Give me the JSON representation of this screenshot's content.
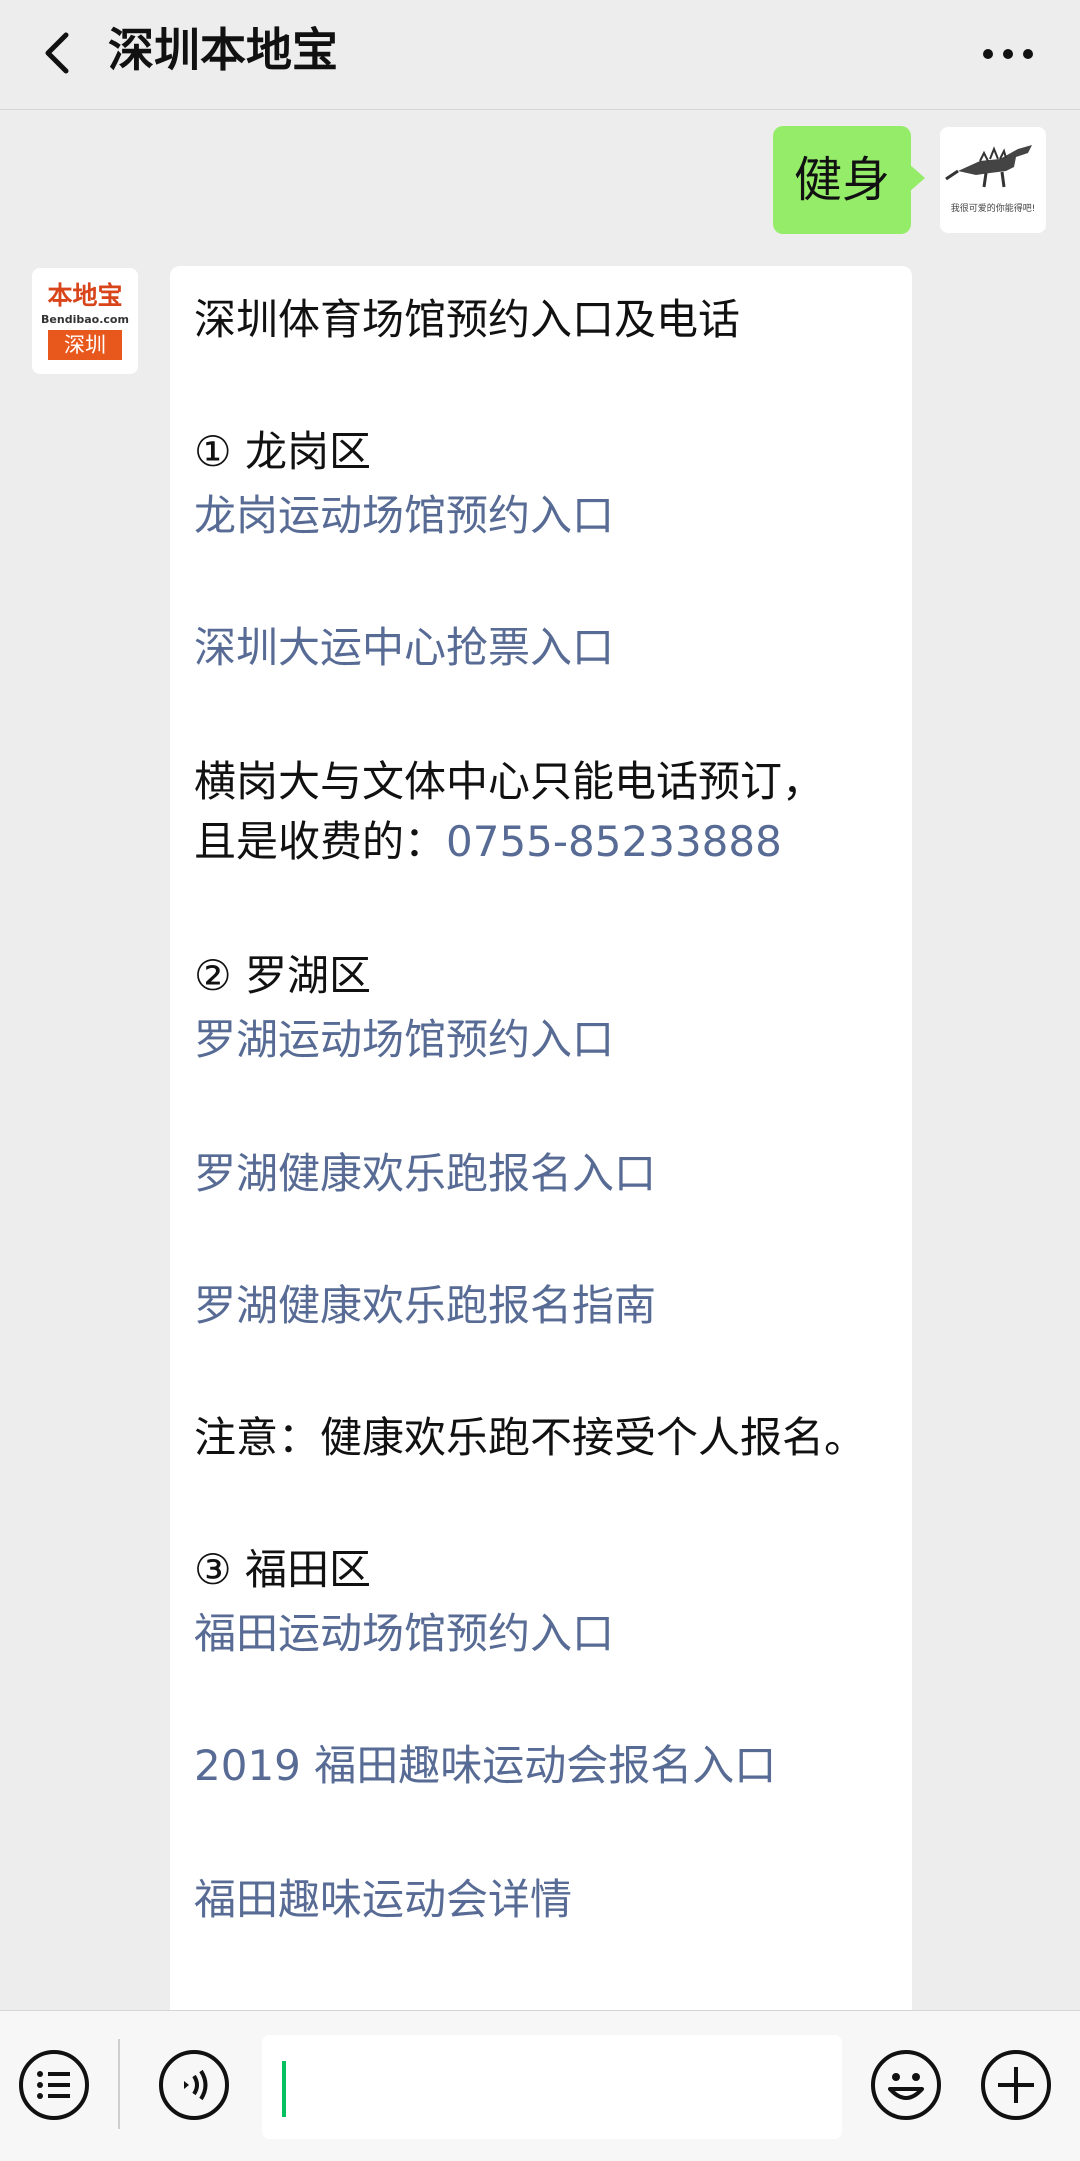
{
  "header": {
    "title": "深圳本地宝",
    "back_icon": "chevron-left-icon",
    "more_icon": "more-dots-icon"
  },
  "messages": {
    "sent": {
      "text": "健身"
    },
    "user_avatar": {
      "caption": "我很可爱的你能得吧!"
    },
    "sender_avatar": {
      "top": "本地宝",
      "mid": "Bendibao.com",
      "bottom": "深圳"
    },
    "reply": {
      "title": "深圳体育场馆预约入口及电话",
      "longgang_header": "① 龙岗区",
      "longgang_link1": "龙岗运动场馆预约入口",
      "longgang_link2": "深圳大运中心抢票入口",
      "hengang_line1": "横岗大与文体中心只能电话预订，",
      "hengang_line2": "且是收费的：",
      "hengang_phone": "0755-85233888",
      "luohu_header": "② 罗湖区",
      "luohu_link1": "罗湖运动场馆预约入口",
      "luohu_link2": "罗湖健康欢乐跑报名入口",
      "luohu_link3": "罗湖健康欢乐跑报名指南",
      "note": "注意：健康欢乐跑不接受个人报名。",
      "futian_header": "③ 福田区",
      "futian_link1": "福田运动场馆预约入口",
      "futian_link2": "2019 福田趣味运动会报名入口",
      "futian_link3": "福田趣味运动会详情"
    }
  },
  "bottom_bar": {
    "menu_icon": "list-menu-icon",
    "voice_icon": "voice-icon",
    "emoji_icon": "emoji-icon",
    "add_icon": "plus-icon"
  },
  "colors": {
    "link": "#576b95",
    "sent_bubble": "#95ec69",
    "background": "#ededed",
    "caret": "#07c160"
  }
}
